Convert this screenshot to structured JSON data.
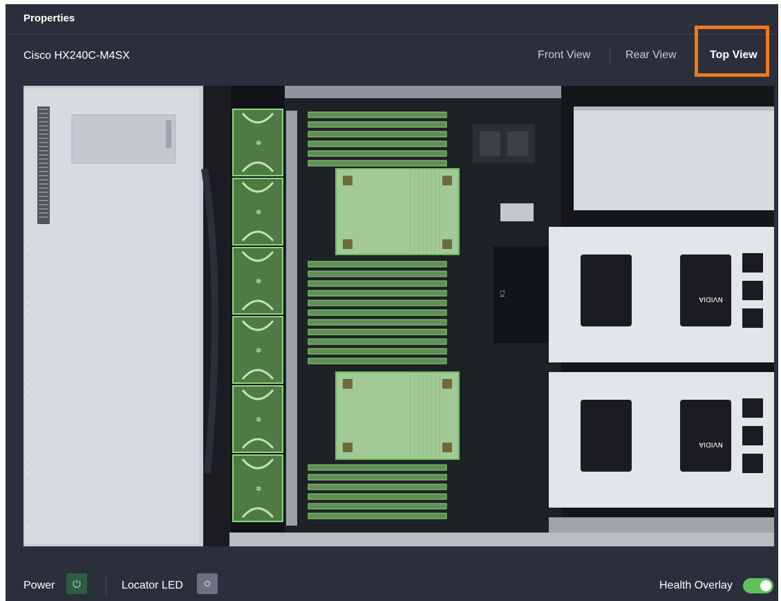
{
  "panel": {
    "title": "Properties"
  },
  "server": {
    "model": "Cisco HX240C-M4SX"
  },
  "views": {
    "tabs": [
      {
        "label": "Front View",
        "active": false
      },
      {
        "label": "Rear View",
        "active": false
      },
      {
        "label": "Top View",
        "active": true
      }
    ]
  },
  "image": {
    "gpu_label_1": "NVIDIA",
    "gpu_label_2": "NVIDIA",
    "cpu_mark": "K1"
  },
  "footer": {
    "power_label": "Power",
    "locator_label": "Locator LED",
    "health_overlay_label": "Health Overlay",
    "health_overlay_on": true
  },
  "colors": {
    "panel_bg": "#2b2f3c",
    "accent_highlight": "#f0791d",
    "health_green": "#5fc25d",
    "power_green": "#2f5d44"
  },
  "icons": {
    "power": "power-icon",
    "locator": "locator-led-icon",
    "fan": "fan-icon"
  }
}
